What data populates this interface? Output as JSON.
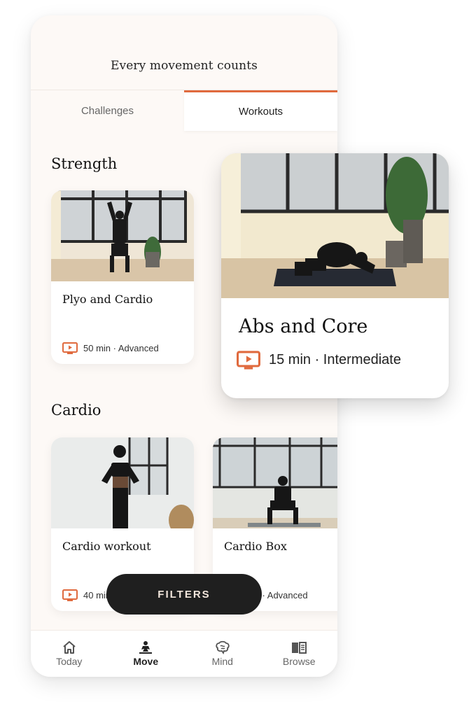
{
  "header": {
    "title": "Every movement counts"
  },
  "tabs": [
    {
      "label": "Challenges",
      "active": false
    },
    {
      "label": "Workouts",
      "active": true
    }
  ],
  "sections": [
    {
      "title": "Strength",
      "cards": [
        {
          "title": "Plyo and Cardio",
          "meta": "50 min · Advanced",
          "icon": "tv-play-icon"
        }
      ]
    },
    {
      "title": "Cardio",
      "cards": [
        {
          "title": "Cardio workout",
          "meta": "40 min",
          "icon": "tv-play-icon"
        },
        {
          "title": "Cardio Box",
          "meta": "min · Advanced",
          "icon": "tv-play-icon"
        }
      ]
    }
  ],
  "featured": {
    "title": "Abs and Core",
    "meta": "15 min · Intermediate",
    "icon": "tv-play-icon"
  },
  "filters_button": {
    "label": "FILTERS"
  },
  "nav": [
    {
      "label": "Today",
      "icon": "home-icon",
      "active": false
    },
    {
      "label": "Move",
      "icon": "meditation-figure-icon",
      "active": true
    },
    {
      "label": "Mind",
      "icon": "brain-icon",
      "active": false
    },
    {
      "label": "Browse",
      "icon": "book-icon",
      "active": false
    }
  ],
  "colors": {
    "accent": "#e06a3e",
    "background": "#fdf9f6",
    "dark": "#1f1f1f"
  }
}
